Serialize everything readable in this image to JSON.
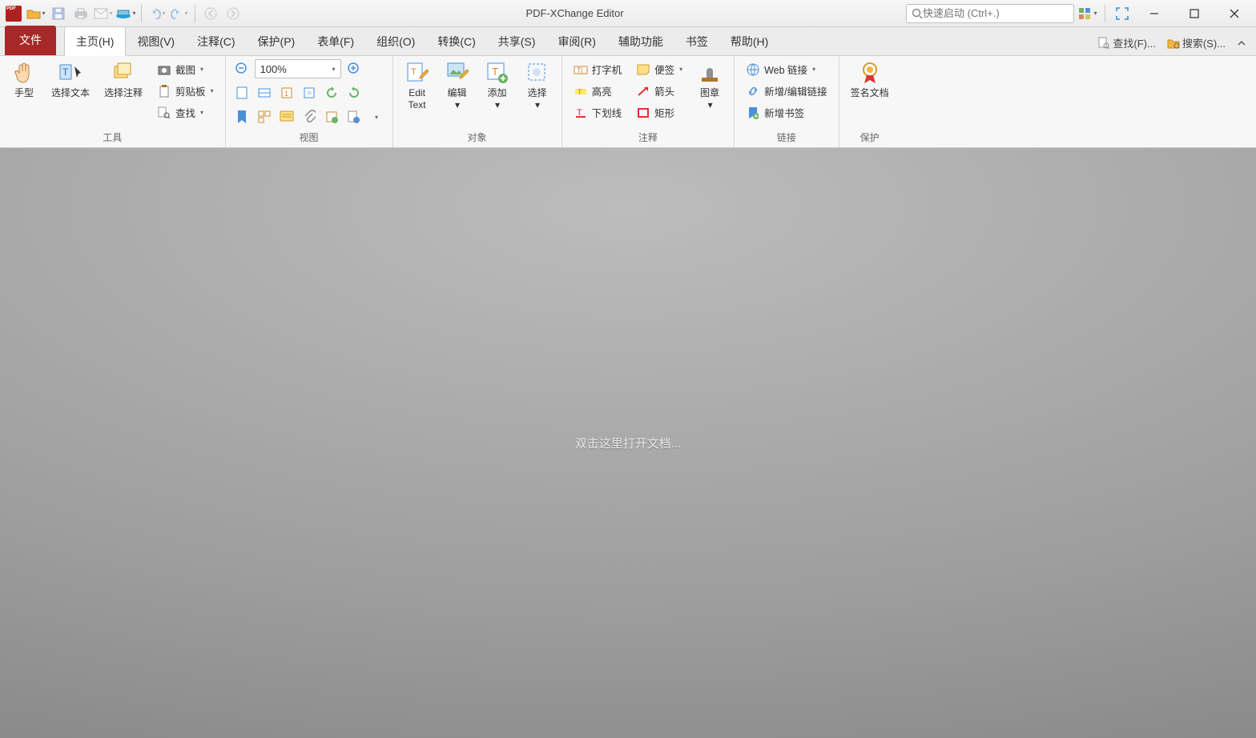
{
  "app": {
    "title": "PDF-XChange Editor"
  },
  "titlebar": {
    "quicklaunch_placeholder": "快速启动 (Ctrl+.)"
  },
  "menubar": {
    "file": "文件",
    "tabs": [
      "主页(H)",
      "视图(V)",
      "注释(C)",
      "保护(P)",
      "表单(F)",
      "组织(O)",
      "转换(C)",
      "共享(S)",
      "审阅(R)",
      "辅助功能",
      "书签",
      "帮助(H)"
    ],
    "right": {
      "find": "查找(F)...",
      "search": "搜索(S)..."
    },
    "collapse_caret": "⌵"
  },
  "ribbon": {
    "groups": {
      "tools": {
        "label": "工具",
        "hand": "手型",
        "select_text": "选择文本",
        "select_anno": "选择注释",
        "screenshot": "截图",
        "clipboard": "剪贴板",
        "find": "查找"
      },
      "view": {
        "label": "视图",
        "zoom_value": "100%"
      },
      "objects": {
        "label": "对象",
        "edit_text_l1": "Edit",
        "edit_text_l2": "Text",
        "edit": "编辑",
        "add": "添加",
        "select": "选择"
      },
      "anno": {
        "label": "注释",
        "typewriter": "打字机",
        "sticky": "便签",
        "highlight": "高亮",
        "arrow": "箭头",
        "underline": "下划线",
        "rect": "矩形",
        "stamp": "图章"
      },
      "links": {
        "label": "链接",
        "weblinks": "Web 链接",
        "editlink": "新增/编辑链接",
        "newbm": "新增书签"
      },
      "protect": {
        "label": "保护",
        "sign": "签名文档"
      }
    }
  },
  "workspace": {
    "hint": "双击这里打开文档..."
  }
}
